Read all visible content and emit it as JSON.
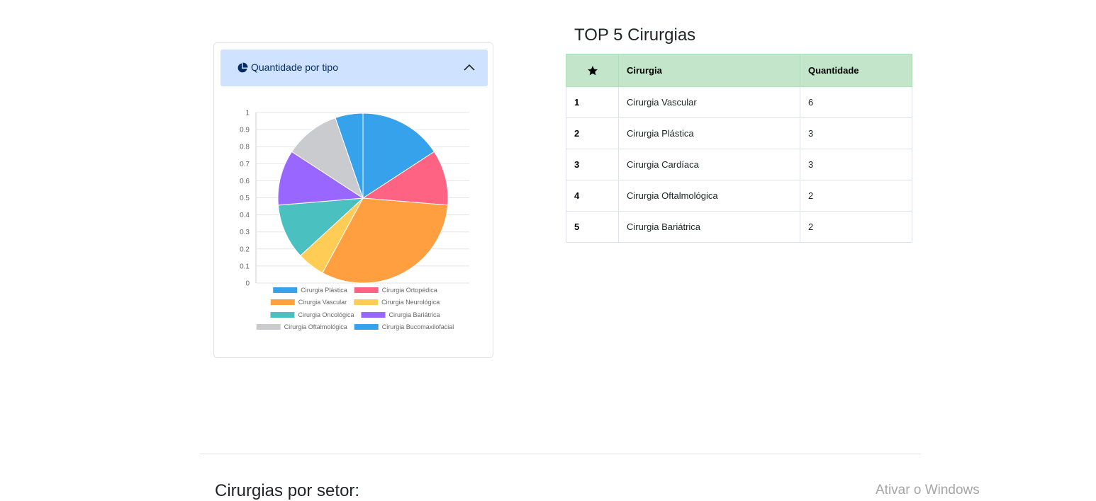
{
  "card": {
    "header_title": "Quantidade por tipo"
  },
  "chart_data": {
    "type": "pie",
    "title": "",
    "y_ticks": [
      "0",
      "0.1",
      "0.2",
      "0.3",
      "0.4",
      "0.5",
      "0.6",
      "0.7",
      "0.8",
      "0.9",
      "1"
    ],
    "slices": [
      {
        "label": "Cirurgia Plástica",
        "value": 3,
        "color": "#36a2eb"
      },
      {
        "label": "Cirurgia Ortopédica",
        "value": 2,
        "color": "#ff6384"
      },
      {
        "label": "Cirurgia Vascular",
        "value": 6,
        "color": "#ff9f40"
      },
      {
        "label": "Cirurgia Neurológica",
        "value": 1,
        "color": "#ffcd56"
      },
      {
        "label": "Cirurgia Oncológica",
        "value": 2,
        "color": "#4bc0c0"
      },
      {
        "label": "Cirurgia Bariátrica",
        "value": 2,
        "color": "#9966ff"
      },
      {
        "label": "Cirurgia Oftalmológica",
        "value": 2,
        "color": "#c9cbcf"
      },
      {
        "label": "Cirurgia Bucomaxilofacial",
        "value": 1,
        "color": "#36a2eb"
      }
    ],
    "legend_position": "bottom",
    "grid": true
  },
  "top5": {
    "title": "TOP 5 Cirurgias",
    "headers": {
      "col2": "Cirurgia",
      "col3": "Quantidade"
    },
    "rows": [
      {
        "rank": "1",
        "name": "Cirurgia Vascular",
        "qty": "6"
      },
      {
        "rank": "2",
        "name": "Cirurgia Plástica",
        "qty": "3"
      },
      {
        "rank": "3",
        "name": "Cirurgia Cardíaca",
        "qty": "3"
      },
      {
        "rank": "4",
        "name": "Cirurgia Oftalmológica",
        "qty": "2"
      },
      {
        "rank": "5",
        "name": "Cirurgia Bariátrica",
        "qty": "2"
      }
    ]
  },
  "sector": {
    "title": "Cirurgias por setor:"
  },
  "watermark": "Ativar o Windows"
}
